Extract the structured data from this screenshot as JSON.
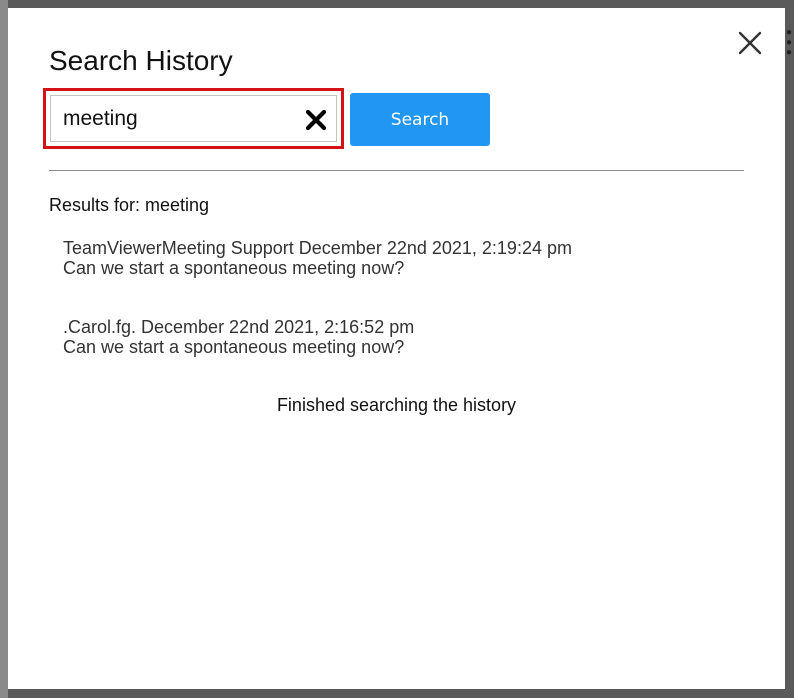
{
  "dialog": {
    "title": "Search History"
  },
  "search": {
    "value": "meeting",
    "button_label": "Search"
  },
  "results": {
    "heading": "Results for: meeting",
    "items": [
      {
        "header": "TeamViewerMeeting Support December 22nd 2021, 2:19:24 pm",
        "message": "Can we start a spontaneous meeting now?"
      },
      {
        "header": ".Carol.fg. December 22nd 2021, 2:16:52 pm",
        "message": "Can we start a spontaneous meeting now?"
      }
    ],
    "status": "Finished searching the history"
  },
  "colors": {
    "accent": "#2196f3",
    "highlight_border": "#d31216"
  },
  "icons": {
    "close": "close-icon",
    "clear": "clear-x-icon"
  }
}
